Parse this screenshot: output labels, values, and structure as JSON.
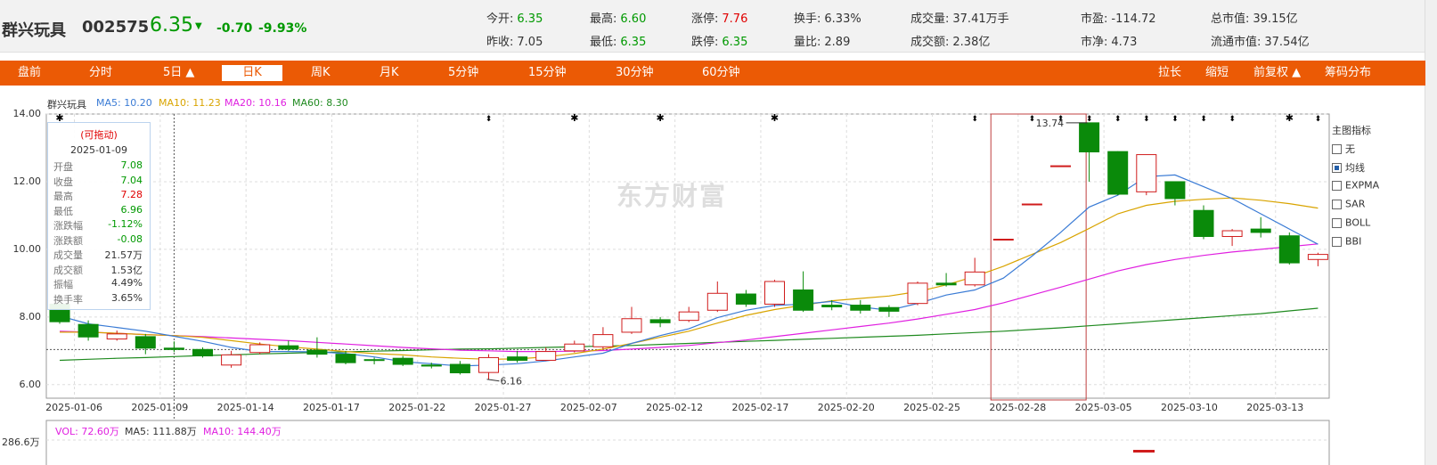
{
  "stock": {
    "name": "群兴玩具",
    "code": "002575",
    "price": "6.35",
    "arrow": "▼",
    "change": "-0.70",
    "pct": "-9.93%"
  },
  "quote": [
    {
      "label": "今开:",
      "value": "6.35",
      "color": "g"
    },
    {
      "label": "最高:",
      "value": "6.60",
      "color": "g"
    },
    {
      "label": "涨停:",
      "value": "7.76",
      "color": "r"
    },
    {
      "label": "换手:",
      "value": "6.33%",
      "color": ""
    },
    {
      "label": "成交量:",
      "value": "37.41万手",
      "color": ""
    },
    {
      "label": "市盈:",
      "value": "-114.72",
      "color": ""
    },
    {
      "label": "总市值:",
      "value": "39.15亿",
      "color": ""
    },
    {
      "label": "昨收:",
      "value": "7.05",
      "color": ""
    },
    {
      "label": "最低:",
      "value": "6.35",
      "color": "g"
    },
    {
      "label": "跌停:",
      "value": "6.35",
      "color": "g"
    },
    {
      "label": "量比:",
      "value": "2.89",
      "color": ""
    },
    {
      "label": "成交额:",
      "value": "2.38亿",
      "color": ""
    },
    {
      "label": "市净:",
      "value": "4.73",
      "color": ""
    },
    {
      "label": "流通市值:",
      "value": "37.54亿",
      "color": ""
    }
  ],
  "nav": [
    "盘前",
    "分时",
    "5日 ▲",
    "日K",
    "周K",
    "月K",
    "5分钟",
    "15分钟",
    "30分钟",
    "60分钟",
    "拉长",
    "缩短",
    "前复权 ▲",
    "筹码分布"
  ],
  "nav_active": 3,
  "legend": {
    "name": "群兴玩具",
    "ma5": "MA5: 10.20",
    "ma10": "MA10: 11.23",
    "ma20": "MA20: 10.16",
    "ma60": "MA60: 8.30",
    "c_ma5": "#3a7bd5",
    "c_ma10": "#d9a400",
    "c_ma20": "#e020e0",
    "c_ma60": "#1f8a1f"
  },
  "watermark": "东方财富",
  "tooltip": {
    "title": "(可拖动)",
    "date": "2025-01-09",
    "rows": [
      {
        "k": "开盘",
        "v": "7.08",
        "c": "g"
      },
      {
        "k": "收盘",
        "v": "7.04",
        "c": "g"
      },
      {
        "k": "最高",
        "v": "7.28",
        "c": "r"
      },
      {
        "k": "最低",
        "v": "6.96",
        "c": "g"
      },
      {
        "k": "涨跌幅",
        "v": "-1.12%",
        "c": "g"
      },
      {
        "k": "涨跌额",
        "v": "-0.08",
        "c": "g"
      },
      {
        "k": "成交量",
        "v": "21.57万",
        "c": ""
      },
      {
        "k": "成交额",
        "v": "1.53亿",
        "c": ""
      },
      {
        "k": "振幅",
        "v": "4.49%",
        "c": ""
      },
      {
        "k": "换手率",
        "v": "3.65%",
        "c": ""
      }
    ]
  },
  "side": {
    "title": "主图指标",
    "items": [
      {
        "label": "无",
        "on": false
      },
      {
        "label": "均线",
        "on": true
      },
      {
        "label": "EXPMA",
        "on": false
      },
      {
        "label": "SAR",
        "on": false
      },
      {
        "label": "BOLL",
        "on": false
      },
      {
        "label": "BBI",
        "on": false
      }
    ]
  },
  "vol_legend": {
    "vol": "VOL: 72.60万",
    "ma5": "MA5: 111.88万",
    "ma10": "MA10: 144.40万"
  },
  "vol_ymax": "286.6万",
  "chart_data": {
    "type": "candlestick",
    "ylim": [
      5.6,
      14.0
    ],
    "yticks": [
      "14.00",
      "12.00",
      "10.00",
      "8.00",
      "6.00"
    ],
    "ytick_values": [
      14,
      12,
      10,
      8,
      6
    ],
    "xticks": [
      "2025-01-06",
      "2025-01-09",
      "2025-01-14",
      "2025-01-17",
      "2025-01-22",
      "2025-01-27",
      "2025-02-07",
      "2025-02-12",
      "2025-02-17",
      "2025-02-20",
      "2025-02-25",
      "2025-02-28",
      "2025-03-05",
      "2025-03-10",
      "2025-03-13"
    ],
    "low_label": "6.16",
    "high_label": "13.74",
    "candles": [
      [
        8.38,
        7.86,
        8.52,
        7.8
      ],
      [
        7.78,
        7.41,
        7.9,
        7.3
      ],
      [
        7.35,
        7.5,
        7.6,
        7.3
      ],
      [
        7.42,
        7.08,
        7.5,
        6.9
      ],
      [
        7.08,
        7.04,
        7.28,
        6.96
      ],
      [
        7.04,
        6.85,
        7.1,
        6.8
      ],
      [
        6.58,
        6.88,
        7.0,
        6.5
      ],
      [
        6.95,
        7.18,
        7.25,
        6.9
      ],
      [
        7.15,
        7.05,
        7.3,
        7.0
      ],
      [
        7.02,
        6.9,
        7.4,
        6.8
      ],
      [
        6.9,
        6.65,
        7.0,
        6.6
      ],
      [
        6.74,
        6.72,
        6.8,
        6.6
      ],
      [
        6.78,
        6.6,
        6.85,
        6.55
      ],
      [
        6.58,
        6.55,
        6.65,
        6.48
      ],
      [
        6.6,
        6.35,
        6.7,
        6.3
      ],
      [
        6.36,
        6.8,
        6.9,
        6.16
      ],
      [
        6.82,
        6.72,
        7.0,
        6.65
      ],
      [
        6.72,
        6.98,
        7.1,
        6.7
      ],
      [
        7.0,
        7.2,
        7.3,
        6.95
      ],
      [
        7.12,
        7.48,
        7.7,
        7.05
      ],
      [
        7.55,
        7.95,
        8.3,
        7.5
      ],
      [
        7.92,
        7.83,
        8.0,
        7.7
      ],
      [
        7.9,
        8.15,
        8.3,
        7.85
      ],
      [
        8.2,
        8.7,
        9.05,
        8.15
      ],
      [
        8.68,
        8.38,
        8.8,
        8.3
      ],
      [
        8.38,
        9.05,
        9.1,
        8.3
      ],
      [
        8.8,
        8.2,
        9.35,
        8.15
      ],
      [
        8.35,
        8.3,
        8.5,
        8.2
      ],
      [
        8.35,
        8.2,
        8.5,
        8.1
      ],
      [
        8.28,
        8.17,
        8.35,
        8.0
      ],
      [
        8.4,
        9.0,
        9.05,
        8.35
      ],
      [
        9.0,
        8.95,
        9.3,
        8.9
      ],
      [
        8.95,
        9.33,
        9.75,
        8.9
      ],
      [
        10.3,
        10.3,
        10.3,
        10.3
      ],
      [
        11.34,
        11.34,
        11.34,
        11.34
      ],
      [
        12.47,
        12.47,
        12.47,
        12.47
      ],
      [
        13.74,
        12.88,
        13.74,
        12.0
      ],
      [
        12.89,
        11.63,
        12.9,
        11.6
      ],
      [
        11.7,
        12.8,
        12.8,
        11.6
      ],
      [
        12.0,
        11.5,
        12.0,
        11.3
      ],
      [
        11.15,
        10.38,
        11.3,
        10.3
      ],
      [
        10.38,
        10.55,
        10.6,
        10.1
      ],
      [
        10.6,
        10.5,
        10.95,
        10.35
      ],
      [
        10.4,
        9.6,
        10.5,
        9.55
      ],
      [
        9.7,
        9.85,
        9.9,
        9.5
      ]
    ],
    "ma5": [
      8.03,
      7.8,
      7.69,
      7.58,
      7.43,
      7.28,
      7.1,
      6.98,
      6.98,
      6.97,
      6.92,
      6.82,
      6.68,
      6.62,
      6.55,
      6.58,
      6.62,
      6.7,
      6.82,
      6.93,
      7.22,
      7.45,
      7.65,
      7.98,
      8.2,
      8.34,
      8.38,
      8.46,
      8.3,
      8.2,
      8.4,
      8.65,
      8.8,
      9.15,
      9.8,
      10.5,
      11.25,
      11.6,
      12.15,
      12.2,
      11.85,
      11.5,
      11.05,
      10.6,
      10.15
    ],
    "ma10": [
      7.55,
      7.55,
      7.52,
      7.48,
      7.45,
      7.4,
      7.3,
      7.2,
      7.12,
      7.05,
      6.98,
      6.92,
      6.88,
      6.82,
      6.78,
      6.75,
      6.76,
      6.82,
      6.92,
      7.05,
      7.22,
      7.4,
      7.58,
      7.82,
      8.05,
      8.22,
      8.35,
      8.48,
      8.55,
      8.62,
      8.75,
      8.95,
      9.2,
      9.5,
      9.85,
      10.2,
      10.62,
      11.05,
      11.3,
      11.42,
      11.48,
      11.52,
      11.45,
      11.35,
      11.22
    ],
    "ma20": [
      7.58,
      7.55,
      7.52,
      7.48,
      7.45,
      7.42,
      7.38,
      7.34,
      7.3,
      7.25,
      7.2,
      7.15,
      7.1,
      7.06,
      7.02,
      7.0,
      6.98,
      6.98,
      6.99,
      7.01,
      7.05,
      7.1,
      7.16,
      7.24,
      7.32,
      7.42,
      7.52,
      7.62,
      7.72,
      7.82,
      7.94,
      8.08,
      8.22,
      8.42,
      8.65,
      8.88,
      9.12,
      9.36,
      9.55,
      9.7,
      9.82,
      9.92,
      10.0,
      10.08,
      10.16
    ],
    "ma60": [
      6.72,
      6.75,
      6.78,
      6.8,
      6.83,
      6.86,
      6.88,
      6.91,
      6.93,
      6.95,
      6.97,
      6.99,
      7.01,
      7.03,
      7.05,
      7.06,
      7.08,
      7.1,
      7.12,
      7.14,
      7.16,
      7.19,
      7.22,
      7.25,
      7.28,
      7.31,
      7.34,
      7.37,
      7.4,
      7.43,
      7.46,
      7.5,
      7.54,
      7.58,
      7.63,
      7.68,
      7.74,
      7.8,
      7.86,
      7.92,
      7.98,
      8.04,
      8.1,
      8.18,
      8.26
    ],
    "markers": [
      "dot",
      null,
      null,
      null,
      null,
      null,
      null,
      null,
      null,
      null,
      null,
      null,
      null,
      null,
      null,
      "bolt",
      null,
      null,
      "dot",
      null,
      null,
      "dot",
      null,
      null,
      null,
      "dot",
      null,
      null,
      null,
      null,
      null,
      null,
      "bolt",
      null,
      "bolt",
      "bolt",
      "bolt",
      "bolt",
      "bolt",
      "bolt",
      "bolt",
      "bolt",
      null,
      "dot",
      "bolt"
    ]
  }
}
